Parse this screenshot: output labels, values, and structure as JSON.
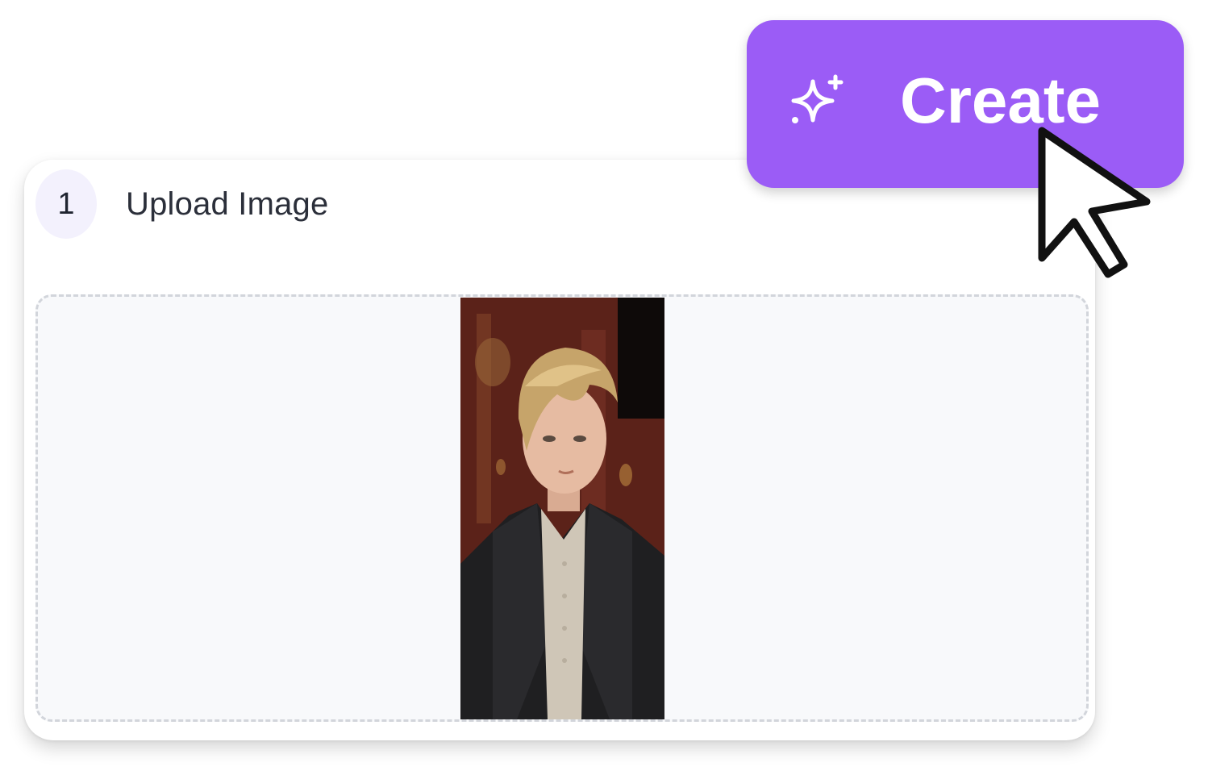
{
  "step": {
    "number": "1",
    "title": "Upload Image"
  },
  "create_button": {
    "label": "Create",
    "icon": "sparkle-icon",
    "color": "#9b5cf6"
  },
  "upload": {
    "image_alt": "uploaded portrait photo"
  },
  "colors": {
    "accent": "#9b5cf6",
    "badge_bg": "#f3f1fd",
    "dropzone_bg": "#f8f9fb"
  }
}
